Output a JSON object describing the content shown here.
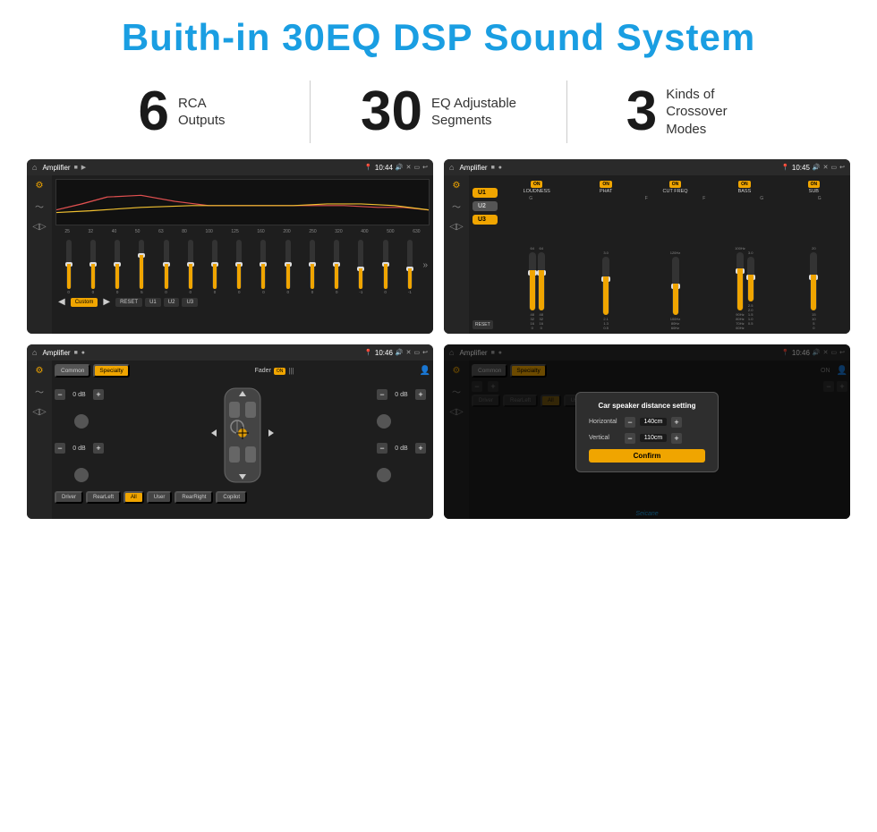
{
  "header": {
    "title": "Buith-in 30EQ DSP Sound System"
  },
  "stats": [
    {
      "number": "6",
      "text": "RCA\nOutputs"
    },
    {
      "number": "30",
      "text": "EQ Adjustable\nSegments"
    },
    {
      "number": "3",
      "text": "Kinds of\nCrossover Modes"
    }
  ],
  "screens": [
    {
      "id": "eq-screen",
      "topbar": {
        "title": "Amplifier",
        "time": "10:44"
      },
      "freqs": [
        "25",
        "32",
        "40",
        "50",
        "63",
        "80",
        "100",
        "125",
        "160",
        "200",
        "250",
        "320",
        "400",
        "500",
        "630"
      ],
      "sliders": [
        0,
        0,
        0,
        5,
        0,
        0,
        0,
        0,
        0,
        0,
        0,
        0,
        -1,
        0,
        -1
      ],
      "buttons": [
        "Custom",
        "RESET",
        "U1",
        "U2",
        "U3"
      ]
    },
    {
      "id": "crossover-screen",
      "topbar": {
        "title": "Amplifier",
        "time": "10:45"
      },
      "channels": [
        "LOUDNESS",
        "PHAT",
        "CUT FREQ",
        "BASS",
        "SUB"
      ],
      "uButtons": [
        "U1",
        "U2",
        "U3"
      ],
      "resetBtn": "RESET"
    },
    {
      "id": "speaker-screen",
      "topbar": {
        "title": "Amplifier",
        "time": "10:46"
      },
      "tabs": [
        "Common",
        "Specialty"
      ],
      "faderLabel": "Fader",
      "positions": [
        "Driver",
        "RearLeft",
        "All",
        "User",
        "RearRight",
        "Copilot"
      ],
      "volumes": [
        "0 dB",
        "0 dB",
        "0 dB",
        "0 dB"
      ]
    },
    {
      "id": "dialog-screen",
      "topbar": {
        "title": "Amplifier",
        "time": "10:46"
      },
      "dialog": {
        "title": "Car speaker distance setting",
        "horizontal_label": "Horizontal",
        "horizontal_value": "140cm",
        "vertical_label": "Vertical",
        "vertical_value": "110cm",
        "confirm_label": "Confirm"
      },
      "positions": [
        "Driver",
        "RearLeft",
        "All",
        "User",
        "RearRight",
        "Copilot"
      ],
      "watermark": "Seicane"
    }
  ]
}
